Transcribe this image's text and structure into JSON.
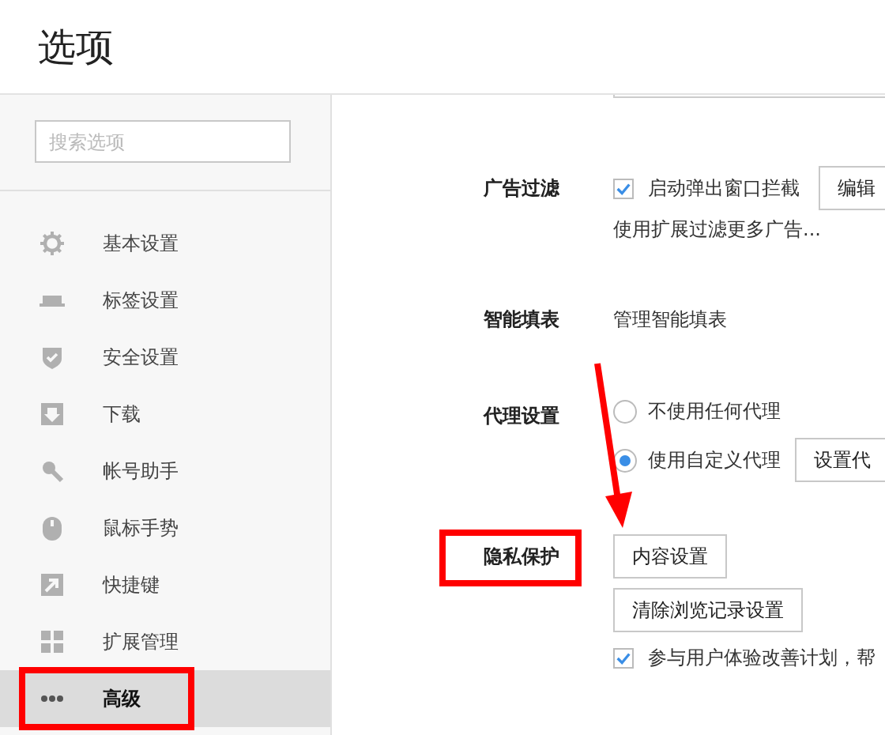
{
  "window": {
    "title": "选项"
  },
  "search": {
    "placeholder": "搜索选项"
  },
  "sidebar": {
    "items": [
      {
        "label": "基本设置",
        "selected": false,
        "highlighted": false
      },
      {
        "label": "标签设置",
        "selected": false,
        "highlighted": false
      },
      {
        "label": "安全设置",
        "selected": false,
        "highlighted": false
      },
      {
        "label": "下载",
        "selected": false,
        "highlighted": false
      },
      {
        "label": "帐号助手",
        "selected": false,
        "highlighted": false
      },
      {
        "label": "鼠标手势",
        "selected": false,
        "highlighted": false
      },
      {
        "label": "快捷键",
        "selected": false,
        "highlighted": false
      },
      {
        "label": "扩展管理",
        "selected": false,
        "highlighted": false
      },
      {
        "label": "高级",
        "selected": true,
        "highlighted": true
      }
    ]
  },
  "content": {
    "partial_field": true,
    "sections": [
      {
        "label": "广告过滤",
        "highlighted": false,
        "rows": [
          {
            "kind": "checkbox",
            "label": "启动弹出窗口拦截",
            "checked": true,
            "button": "编辑"
          },
          {
            "kind": "text",
            "label": "使用扩展过滤更多广告..."
          }
        ]
      },
      {
        "label": "智能填表",
        "highlighted": false,
        "rows": [
          {
            "kind": "text",
            "label": "管理智能填表"
          }
        ]
      },
      {
        "label": "代理设置",
        "highlighted": false,
        "rows": [
          {
            "kind": "radio",
            "label": "不使用任何代理",
            "selected": false
          },
          {
            "kind": "radio",
            "label": "使用自定义代理",
            "selected": true,
            "button": "设置代"
          }
        ]
      },
      {
        "label": "隐私保护",
        "highlighted": true,
        "rows": [
          {
            "kind": "button",
            "label": "内容设置"
          },
          {
            "kind": "button",
            "label": "清除浏览记录设置"
          },
          {
            "kind": "checkbox",
            "label": "参与用户体验改善计划，帮",
            "checked": true
          }
        ]
      }
    ]
  },
  "annotation_arrow": true
}
